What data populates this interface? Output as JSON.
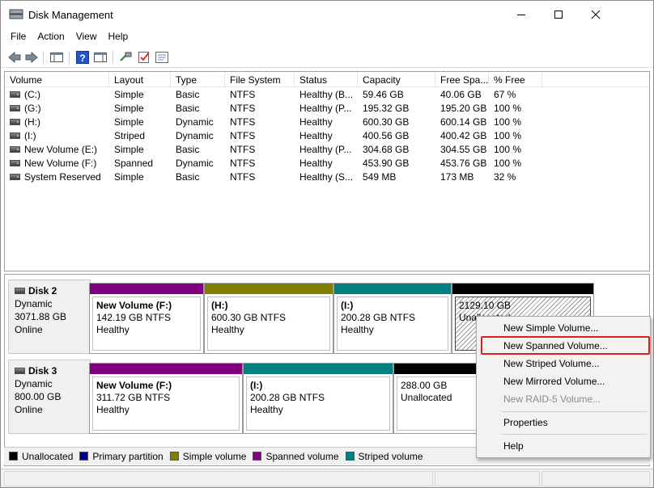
{
  "window": {
    "title": "Disk Management"
  },
  "menu": [
    "File",
    "Action",
    "View",
    "Help"
  ],
  "columns": [
    "Volume",
    "Layout",
    "Type",
    "File System",
    "Status",
    "Capacity",
    "Free Spa...",
    "% Free"
  ],
  "volumes": [
    {
      "name": "(C:)",
      "layout": "Simple",
      "type": "Basic",
      "fs": "NTFS",
      "status": "Healthy (B...",
      "capacity": "59.46 GB",
      "free": "40.06 GB",
      "pct": "67 %"
    },
    {
      "name": "(G:)",
      "layout": "Simple",
      "type": "Basic",
      "fs": "NTFS",
      "status": "Healthy (P...",
      "capacity": "195.32 GB",
      "free": "195.20 GB",
      "pct": "100 %"
    },
    {
      "name": "(H:)",
      "layout": "Simple",
      "type": "Dynamic",
      "fs": "NTFS",
      "status": "Healthy",
      "capacity": "600.30 GB",
      "free": "600.14 GB",
      "pct": "100 %"
    },
    {
      "name": "(I:)",
      "layout": "Striped",
      "type": "Dynamic",
      "fs": "NTFS",
      "status": "Healthy",
      "capacity": "400.56 GB",
      "free": "400.42 GB",
      "pct": "100 %"
    },
    {
      "name": "New Volume (E:)",
      "layout": "Simple",
      "type": "Basic",
      "fs": "NTFS",
      "status": "Healthy (P...",
      "capacity": "304.68 GB",
      "free": "304.55 GB",
      "pct": "100 %"
    },
    {
      "name": "New Volume (F:)",
      "layout": "Spanned",
      "type": "Dynamic",
      "fs": "NTFS",
      "status": "Healthy",
      "capacity": "453.90 GB",
      "free": "453.76 GB",
      "pct": "100 %"
    },
    {
      "name": "System Reserved",
      "layout": "Simple",
      "type": "Basic",
      "fs": "NTFS",
      "status": "Healthy (S...",
      "capacity": "549 MB",
      "free": "173 MB",
      "pct": "32 %"
    }
  ],
  "disks": [
    {
      "name": "Disk 2",
      "kind": "Dynamic",
      "size": "3071.88 GB",
      "state": "Online",
      "partitions": [
        {
          "title": "New Volume  (F:)",
          "size": "142.19 GB NTFS",
          "status": "Healthy"
        },
        {
          "title": "(H:)",
          "size": "600.30 GB NTFS",
          "status": "Healthy"
        },
        {
          "title": "(I:)",
          "size": "200.28 GB NTFS",
          "status": "Healthy"
        },
        {
          "title": "",
          "size": "2129.10 GB",
          "status": "Unallocated"
        }
      ]
    },
    {
      "name": "Disk 3",
      "kind": "Dynamic",
      "size": "800.00 GB",
      "state": "Online",
      "partitions": [
        {
          "title": "New Volume  (F:)",
          "size": "311.72 GB NTFS",
          "status": "Healthy"
        },
        {
          "title": "(I:)",
          "size": "200.28 GB NTFS",
          "status": "Healthy"
        },
        {
          "title": "",
          "size": "288.00 GB",
          "status": "Unallocated"
        }
      ]
    }
  ],
  "legend": [
    {
      "label": "Unallocated",
      "color": "#000000"
    },
    {
      "label": "Primary partition",
      "color": "#00008b"
    },
    {
      "label": "Simple volume",
      "color": "#808000"
    },
    {
      "label": "Spanned volume",
      "color": "#800080"
    },
    {
      "label": "Striped volume",
      "color": "#008080"
    }
  ],
  "context_menu": {
    "items": [
      "New Simple Volume...",
      "New Spanned Volume...",
      "New Striped Volume...",
      "New Mirrored Volume...",
      "New RAID-5 Volume..."
    ],
    "disabled": "New RAID-5 Volume...",
    "highlighted": "New Spanned Volume...",
    "properties": "Properties",
    "help": "Help"
  },
  "colors": {
    "spanned": "#800080",
    "simple": "#808000",
    "striped": "#008080",
    "unallocated": "#000000",
    "highlight": "#e02020"
  }
}
